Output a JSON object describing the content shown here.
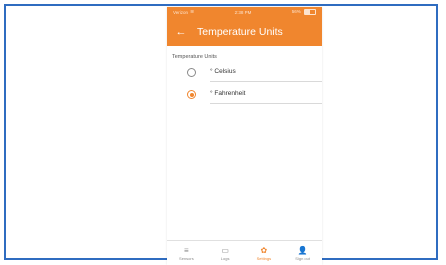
{
  "status_bar": {
    "carrier": "Verizon",
    "time": "2:38 PM",
    "battery": "56%",
    "wifi_icon": "wifi-icon",
    "battery_icon": "battery-icon"
  },
  "app_bar": {
    "back_icon": "←",
    "title": "Temperature Units"
  },
  "section_label": "Temperature Units",
  "options": [
    {
      "label": "° Celsius",
      "checked": false
    },
    {
      "label": "° Fahrenheit",
      "checked": true
    }
  ],
  "bottom_nav": [
    {
      "icon": "≡",
      "icon_name": "sensors-icon",
      "label": "Sensors",
      "active": false
    },
    {
      "icon": "▭",
      "icon_name": "folder-icon",
      "label": "Logs",
      "active": false
    },
    {
      "icon": "✿",
      "icon_name": "gear-icon",
      "label": "Settings",
      "active": true
    },
    {
      "icon": "👤",
      "icon_name": "person-icon",
      "label": "Sign out",
      "active": false
    }
  ],
  "colors": {
    "accent": "#f0862e",
    "frame_border": "#2f6cc0"
  }
}
